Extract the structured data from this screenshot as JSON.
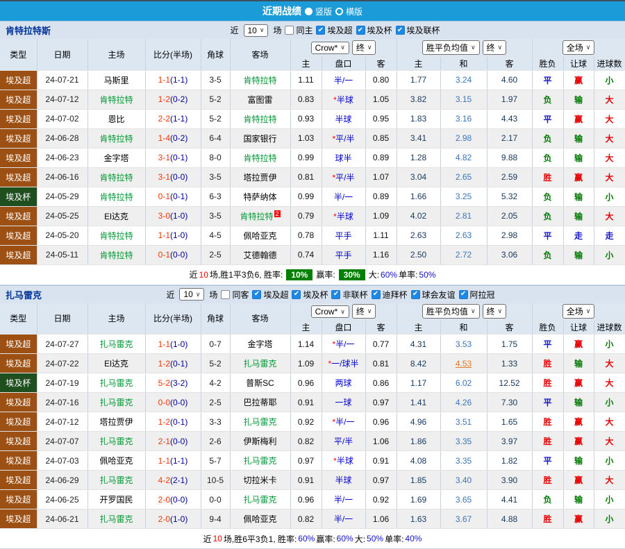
{
  "titlebar": {
    "title": "近期战绩",
    "options": [
      {
        "label": "竖版",
        "selected": true
      },
      {
        "label": "横版",
        "selected": false
      }
    ]
  },
  "controls": {
    "near": "近",
    "matches": "场"
  },
  "columns": {
    "type": "类型",
    "date": "日期",
    "home": "主场",
    "score": "比分(半场)",
    "corner": "角球",
    "away": "客场",
    "sub": [
      "主",
      "盘口",
      "客",
      "主",
      "和",
      "客",
      "胜负",
      "让球",
      "进球数"
    ]
  },
  "colors": {
    "topbar": "#1B9BD8",
    "type_badges": {
      "埃及超": "#9C5013",
      "埃及杯": "#1F4F1F"
    },
    "result_colors": {
      "胜": "#E60000",
      "平": "#1414CC",
      "负": "#007A00",
      "赢": "#E60000",
      "走": "#1414CC",
      "输": "#007A00",
      "大": "#E60000",
      "小": "#007A00"
    },
    "self_team": "#009933",
    "summary_badge": "#008000"
  },
  "tables": [
    {
      "team": "肯特拉特斯",
      "filter": {
        "count": "10",
        "same": {
          "label": "同主",
          "checked": false
        },
        "leagues": [
          "埃及超",
          "埃及杯",
          "埃及联杯"
        ]
      },
      "selectors": {
        "odds_source": "Crow*",
        "odds_state": "终",
        "avg_label": "胜平负均值",
        "avg_state": "终",
        "scope": "全场"
      },
      "rows": [
        {
          "type": "埃及超",
          "date": "24-07-21",
          "home": "马斯里",
          "home_self": false,
          "score": "1-1",
          "half": "(1-1)",
          "corners": "3-5",
          "away": "肯特拉特",
          "away_self": true,
          "odds_home": "1.11",
          "handicap": "半/一",
          "handicap_star": false,
          "odds_away": "0.80",
          "avg_win": "1.77",
          "avg_draw": "3.24",
          "avg_lose": "4.60",
          "draw_hl": false,
          "outcome": "平",
          "cover": "赢",
          "goals": "小"
        },
        {
          "type": "埃及超",
          "date": "24-07-12",
          "home": "肯特拉特",
          "home_self": true,
          "score": "1-2",
          "half": "(0-2)",
          "corners": "5-2",
          "away": "富图雷",
          "away_self": false,
          "odds_home": "0.83",
          "handicap": "半球",
          "handicap_star": true,
          "odds_away": "1.05",
          "avg_win": "3.82",
          "avg_draw": "3.15",
          "avg_lose": "1.97",
          "draw_hl": false,
          "outcome": "负",
          "cover": "输",
          "goals": "大"
        },
        {
          "type": "埃及超",
          "date": "24-07-02",
          "home": "恩比",
          "home_self": false,
          "score": "2-2",
          "half": "(1-1)",
          "corners": "5-2",
          "away": "肯特拉特",
          "away_self": true,
          "odds_home": "0.93",
          "handicap": "半球",
          "handicap_star": false,
          "odds_away": "0.95",
          "avg_win": "1.83",
          "avg_draw": "3.16",
          "avg_lose": "4.43",
          "draw_hl": false,
          "outcome": "平",
          "cover": "赢",
          "goals": "大"
        },
        {
          "type": "埃及超",
          "date": "24-06-28",
          "home": "肯特拉特",
          "home_self": true,
          "score": "1-4",
          "half": "(0-2)",
          "corners": "6-4",
          "away": "国家银行",
          "away_self": false,
          "odds_home": "1.03",
          "handicap": "平/半",
          "handicap_star": true,
          "odds_away": "0.85",
          "avg_win": "3.41",
          "avg_draw": "2.98",
          "avg_lose": "2.17",
          "draw_hl": false,
          "outcome": "负",
          "cover": "输",
          "goals": "大"
        },
        {
          "type": "埃及超",
          "date": "24-06-23",
          "home": "金字塔",
          "home_self": false,
          "score": "3-1",
          "half": "(0-1)",
          "corners": "8-0",
          "away": "肯特拉特",
          "away_self": true,
          "odds_home": "0.99",
          "handicap": "球半",
          "handicap_star": false,
          "odds_away": "0.89",
          "avg_win": "1.28",
          "avg_draw": "4.82",
          "avg_lose": "9.88",
          "draw_hl": false,
          "outcome": "负",
          "cover": "输",
          "goals": "大"
        },
        {
          "type": "埃及超",
          "date": "24-06-16",
          "home": "肯特拉特",
          "home_self": true,
          "score": "3-1",
          "half": "(0-0)",
          "corners": "3-5",
          "away": "塔拉贾伊",
          "away_self": false,
          "odds_home": "0.81",
          "handicap": "平/半",
          "handicap_star": true,
          "odds_away": "1.07",
          "avg_win": "3.04",
          "avg_draw": "2.65",
          "avg_lose": "2.59",
          "draw_hl": false,
          "outcome": "胜",
          "cover": "赢",
          "goals": "大"
        },
        {
          "type": "埃及杯",
          "date": "24-05-29",
          "home": "肯特拉特",
          "home_self": true,
          "score": "0-1",
          "half": "(0-1)",
          "corners": "6-3",
          "away": "特萨纳体",
          "away_self": false,
          "odds_home": "0.99",
          "handicap": "半/一",
          "handicap_star": false,
          "odds_away": "0.89",
          "avg_win": "1.66",
          "avg_draw": "3.25",
          "avg_lose": "5.32",
          "draw_hl": false,
          "outcome": "负",
          "cover": "输",
          "goals": "小"
        },
        {
          "type": "埃及超",
          "date": "24-05-25",
          "home": "El达克",
          "home_self": false,
          "score": "3-0",
          "half": "(1-0)",
          "corners": "3-5",
          "away": "肯特拉特",
          "away_self": true,
          "away_sup": "2",
          "odds_home": "0.79",
          "handicap": "半球",
          "handicap_star": true,
          "odds_away": "1.09",
          "avg_win": "4.02",
          "avg_draw": "2.81",
          "avg_lose": "2.05",
          "draw_hl": false,
          "outcome": "负",
          "cover": "输",
          "goals": "大"
        },
        {
          "type": "埃及超",
          "date": "24-05-20",
          "home": "肯特拉特",
          "home_self": true,
          "score": "1-1",
          "half": "(1-0)",
          "corners": "4-5",
          "away": "佩哈亚克",
          "away_self": false,
          "odds_home": "0.78",
          "handicap": "平手",
          "handicap_star": false,
          "odds_away": "1.11",
          "avg_win": "2.63",
          "avg_draw": "2.63",
          "avg_lose": "2.98",
          "draw_hl": false,
          "outcome": "平",
          "cover": "走",
          "goals": "走"
        },
        {
          "type": "埃及超",
          "date": "24-05-11",
          "home": "肯特拉特",
          "home_self": true,
          "score": "0-1",
          "half": "(0-0)",
          "corners": "2-5",
          "away": "艾德翰德",
          "away_self": false,
          "odds_home": "0.74",
          "handicap": "平手",
          "handicap_star": false,
          "odds_away": "1.16",
          "avg_win": "2.50",
          "avg_draw": "2.72",
          "avg_lose": "3.06",
          "draw_hl": false,
          "outcome": "负",
          "cover": "输",
          "goals": "小"
        }
      ],
      "summary": [
        {
          "text": "近"
        },
        {
          "text": "10",
          "style": "red"
        },
        {
          "text": "场,胜1平3负6, 胜率:"
        },
        {
          "text": "10%",
          "style": "badge"
        },
        {
          "text": "赢率:"
        },
        {
          "text": "30%",
          "style": "badge"
        },
        {
          "text": "大:"
        },
        {
          "text": "60%",
          "style": "blue"
        },
        {
          "text": "单率:"
        },
        {
          "text": "50%",
          "style": "blue"
        }
      ]
    },
    {
      "team": "扎马雷克",
      "filter": {
        "count": "10",
        "same": {
          "label": "同客",
          "checked": false
        },
        "leagues": [
          "埃及超",
          "埃及杯",
          "非联杯",
          "迪拜杯",
          "球会友谊",
          "阿拉冠"
        ]
      },
      "selectors": {
        "odds_source": "Crow*",
        "odds_state": "终",
        "avg_label": "胜平负均值",
        "avg_state": "终",
        "scope": "全场"
      },
      "rows": [
        {
          "type": "埃及超",
          "date": "24-07-27",
          "home": "扎马雷克",
          "home_self": true,
          "score": "1-1",
          "half": "(1-0)",
          "corners": "0-7",
          "away": "金字塔",
          "away_self": false,
          "odds_home": "1.14",
          "handicap": "半/一",
          "handicap_star": true,
          "odds_away": "0.77",
          "avg_win": "4.31",
          "avg_draw": "3.53",
          "avg_lose": "1.75",
          "draw_hl": false,
          "outcome": "平",
          "cover": "赢",
          "goals": "小"
        },
        {
          "type": "埃及超",
          "date": "24-07-22",
          "home": "El达克",
          "home_self": false,
          "score": "1-2",
          "half": "(0-1)",
          "corners": "5-2",
          "away": "扎马雷克",
          "away_self": true,
          "odds_home": "1.09",
          "handicap": "一/球半",
          "handicap_star": true,
          "odds_away": "0.81",
          "avg_win": "8.42",
          "avg_draw": "4.53",
          "avg_lose": "1.33",
          "draw_hl": true,
          "outcome": "胜",
          "cover": "输",
          "goals": "大"
        },
        {
          "type": "埃及杯",
          "date": "24-07-19",
          "home": "扎马雷克",
          "home_self": true,
          "score": "5-2",
          "half": "(3-2)",
          "corners": "4-2",
          "away": "普斯SC",
          "away_self": false,
          "odds_home": "0.96",
          "handicap": "两球",
          "handicap_star": false,
          "odds_away": "0.86",
          "avg_win": "1.17",
          "avg_draw": "6.02",
          "avg_lose": "12.52",
          "draw_hl": false,
          "outcome": "胜",
          "cover": "赢",
          "goals": "大"
        },
        {
          "type": "埃及超",
          "date": "24-07-16",
          "home": "扎马雷克",
          "home_self": true,
          "score": "0-0",
          "half": "(0-0)",
          "corners": "2-5",
          "away": "巴拉蒂耶",
          "away_self": false,
          "odds_home": "0.91",
          "handicap": "一球",
          "handicap_star": false,
          "odds_away": "0.97",
          "avg_win": "1.41",
          "avg_draw": "4.26",
          "avg_lose": "7.30",
          "draw_hl": false,
          "outcome": "平",
          "cover": "输",
          "goals": "小"
        },
        {
          "type": "埃及超",
          "date": "24-07-12",
          "home": "塔拉贾伊",
          "home_self": false,
          "score": "1-2",
          "half": "(0-1)",
          "corners": "3-3",
          "away": "扎马雷克",
          "away_self": true,
          "odds_home": "0.92",
          "handicap": "半/一",
          "handicap_star": true,
          "odds_away": "0.96",
          "avg_win": "4.96",
          "avg_draw": "3.51",
          "avg_lose": "1.65",
          "draw_hl": false,
          "outcome": "胜",
          "cover": "赢",
          "goals": "大"
        },
        {
          "type": "埃及超",
          "date": "24-07-07",
          "home": "扎马雷克",
          "home_self": true,
          "score": "2-1",
          "half": "(0-0)",
          "corners": "2-6",
          "away": "伊斯梅利",
          "away_self": false,
          "odds_home": "0.82",
          "handicap": "平/半",
          "handicap_star": false,
          "odds_away": "1.06",
          "avg_win": "1.86",
          "avg_draw": "3.35",
          "avg_lose": "3.97",
          "draw_hl": false,
          "outcome": "胜",
          "cover": "赢",
          "goals": "大"
        },
        {
          "type": "埃及超",
          "date": "24-07-03",
          "home": "佩哈亚克",
          "home_self": false,
          "score": "1-1",
          "half": "(1-1)",
          "corners": "5-7",
          "away": "扎马雷克",
          "away_self": true,
          "odds_home": "0.97",
          "handicap": "半球",
          "handicap_star": true,
          "odds_away": "0.91",
          "avg_win": "4.08",
          "avg_draw": "3.35",
          "avg_lose": "1.82",
          "draw_hl": false,
          "outcome": "平",
          "cover": "输",
          "goals": "小"
        },
        {
          "type": "埃及超",
          "date": "24-06-29",
          "home": "扎马雷克",
          "home_self": true,
          "score": "4-2",
          "half": "(2-1)",
          "corners": "10-5",
          "away": "切拉米卡",
          "away_self": false,
          "odds_home": "0.91",
          "handicap": "半球",
          "handicap_star": false,
          "odds_away": "0.97",
          "avg_win": "1.85",
          "avg_draw": "3.40",
          "avg_lose": "3.90",
          "draw_hl": false,
          "outcome": "胜",
          "cover": "赢",
          "goals": "大"
        },
        {
          "type": "埃及超",
          "date": "24-06-25",
          "home": "开罗国民",
          "home_self": false,
          "score": "2-0",
          "half": "(0-0)",
          "corners": "0-0",
          "away": "扎马雷克",
          "away_self": true,
          "odds_home": "0.96",
          "handicap": "半/一",
          "handicap_star": false,
          "odds_away": "0.92",
          "avg_win": "1.69",
          "avg_draw": "3.65",
          "avg_lose": "4.41",
          "draw_hl": false,
          "outcome": "负",
          "cover": "输",
          "goals": "小"
        },
        {
          "type": "埃及超",
          "date": "24-06-21",
          "home": "扎马雷克",
          "home_self": true,
          "score": "2-0",
          "half": "(1-0)",
          "corners": "9-4",
          "away": "佩哈亚克",
          "away_self": false,
          "odds_home": "0.82",
          "handicap": "半/一",
          "handicap_star": false,
          "odds_away": "1.06",
          "avg_win": "1.63",
          "avg_draw": "3.67",
          "avg_lose": "4.88",
          "draw_hl": false,
          "outcome": "胜",
          "cover": "赢",
          "goals": "小"
        }
      ],
      "summary": [
        {
          "text": "近"
        },
        {
          "text": "10",
          "style": "red"
        },
        {
          "text": "场,胜6平3负1, 胜率:"
        },
        {
          "text": "60%",
          "style": "blue"
        },
        {
          "text": "赢率:"
        },
        {
          "text": "60%",
          "style": "blue"
        },
        {
          "text": "大:"
        },
        {
          "text": "50%",
          "style": "blue"
        },
        {
          "text": "单率:"
        },
        {
          "text": "40%",
          "style": "blue"
        }
      ]
    }
  ]
}
